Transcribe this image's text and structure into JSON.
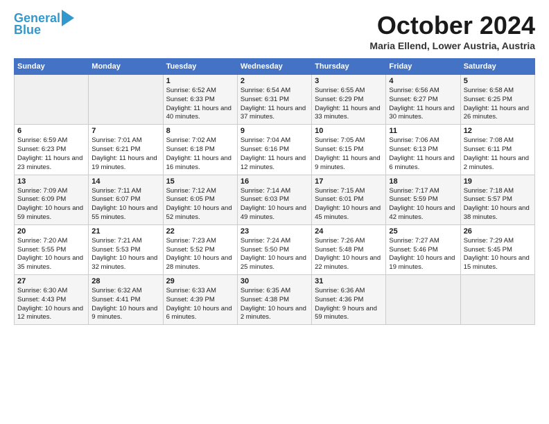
{
  "header": {
    "logo_line1": "General",
    "logo_line2": "Blue",
    "month": "October 2024",
    "location": "Maria Ellend, Lower Austria, Austria"
  },
  "days_of_week": [
    "Sunday",
    "Monday",
    "Tuesday",
    "Wednesday",
    "Thursday",
    "Friday",
    "Saturday"
  ],
  "weeks": [
    [
      {
        "day": "",
        "info": ""
      },
      {
        "day": "",
        "info": ""
      },
      {
        "day": "1",
        "info": "Sunrise: 6:52 AM\nSunset: 6:33 PM\nDaylight: 11 hours and 40 minutes."
      },
      {
        "day": "2",
        "info": "Sunrise: 6:54 AM\nSunset: 6:31 PM\nDaylight: 11 hours and 37 minutes."
      },
      {
        "day": "3",
        "info": "Sunrise: 6:55 AM\nSunset: 6:29 PM\nDaylight: 11 hours and 33 minutes."
      },
      {
        "day": "4",
        "info": "Sunrise: 6:56 AM\nSunset: 6:27 PM\nDaylight: 11 hours and 30 minutes."
      },
      {
        "day": "5",
        "info": "Sunrise: 6:58 AM\nSunset: 6:25 PM\nDaylight: 11 hours and 26 minutes."
      }
    ],
    [
      {
        "day": "6",
        "info": "Sunrise: 6:59 AM\nSunset: 6:23 PM\nDaylight: 11 hours and 23 minutes."
      },
      {
        "day": "7",
        "info": "Sunrise: 7:01 AM\nSunset: 6:21 PM\nDaylight: 11 hours and 19 minutes."
      },
      {
        "day": "8",
        "info": "Sunrise: 7:02 AM\nSunset: 6:18 PM\nDaylight: 11 hours and 16 minutes."
      },
      {
        "day": "9",
        "info": "Sunrise: 7:04 AM\nSunset: 6:16 PM\nDaylight: 11 hours and 12 minutes."
      },
      {
        "day": "10",
        "info": "Sunrise: 7:05 AM\nSunset: 6:15 PM\nDaylight: 11 hours and 9 minutes."
      },
      {
        "day": "11",
        "info": "Sunrise: 7:06 AM\nSunset: 6:13 PM\nDaylight: 11 hours and 6 minutes."
      },
      {
        "day": "12",
        "info": "Sunrise: 7:08 AM\nSunset: 6:11 PM\nDaylight: 11 hours and 2 minutes."
      }
    ],
    [
      {
        "day": "13",
        "info": "Sunrise: 7:09 AM\nSunset: 6:09 PM\nDaylight: 10 hours and 59 minutes."
      },
      {
        "day": "14",
        "info": "Sunrise: 7:11 AM\nSunset: 6:07 PM\nDaylight: 10 hours and 55 minutes."
      },
      {
        "day": "15",
        "info": "Sunrise: 7:12 AM\nSunset: 6:05 PM\nDaylight: 10 hours and 52 minutes."
      },
      {
        "day": "16",
        "info": "Sunrise: 7:14 AM\nSunset: 6:03 PM\nDaylight: 10 hours and 49 minutes."
      },
      {
        "day": "17",
        "info": "Sunrise: 7:15 AM\nSunset: 6:01 PM\nDaylight: 10 hours and 45 minutes."
      },
      {
        "day": "18",
        "info": "Sunrise: 7:17 AM\nSunset: 5:59 PM\nDaylight: 10 hours and 42 minutes."
      },
      {
        "day": "19",
        "info": "Sunrise: 7:18 AM\nSunset: 5:57 PM\nDaylight: 10 hours and 38 minutes."
      }
    ],
    [
      {
        "day": "20",
        "info": "Sunrise: 7:20 AM\nSunset: 5:55 PM\nDaylight: 10 hours and 35 minutes."
      },
      {
        "day": "21",
        "info": "Sunrise: 7:21 AM\nSunset: 5:53 PM\nDaylight: 10 hours and 32 minutes."
      },
      {
        "day": "22",
        "info": "Sunrise: 7:23 AM\nSunset: 5:52 PM\nDaylight: 10 hours and 28 minutes."
      },
      {
        "day": "23",
        "info": "Sunrise: 7:24 AM\nSunset: 5:50 PM\nDaylight: 10 hours and 25 minutes."
      },
      {
        "day": "24",
        "info": "Sunrise: 7:26 AM\nSunset: 5:48 PM\nDaylight: 10 hours and 22 minutes."
      },
      {
        "day": "25",
        "info": "Sunrise: 7:27 AM\nSunset: 5:46 PM\nDaylight: 10 hours and 19 minutes."
      },
      {
        "day": "26",
        "info": "Sunrise: 7:29 AM\nSunset: 5:45 PM\nDaylight: 10 hours and 15 minutes."
      }
    ],
    [
      {
        "day": "27",
        "info": "Sunrise: 6:30 AM\nSunset: 4:43 PM\nDaylight: 10 hours and 12 minutes."
      },
      {
        "day": "28",
        "info": "Sunrise: 6:32 AM\nSunset: 4:41 PM\nDaylight: 10 hours and 9 minutes."
      },
      {
        "day": "29",
        "info": "Sunrise: 6:33 AM\nSunset: 4:39 PM\nDaylight: 10 hours and 6 minutes."
      },
      {
        "day": "30",
        "info": "Sunrise: 6:35 AM\nSunset: 4:38 PM\nDaylight: 10 hours and 2 minutes."
      },
      {
        "day": "31",
        "info": "Sunrise: 6:36 AM\nSunset: 4:36 PM\nDaylight: 9 hours and 59 minutes."
      },
      {
        "day": "",
        "info": ""
      },
      {
        "day": "",
        "info": ""
      }
    ]
  ]
}
